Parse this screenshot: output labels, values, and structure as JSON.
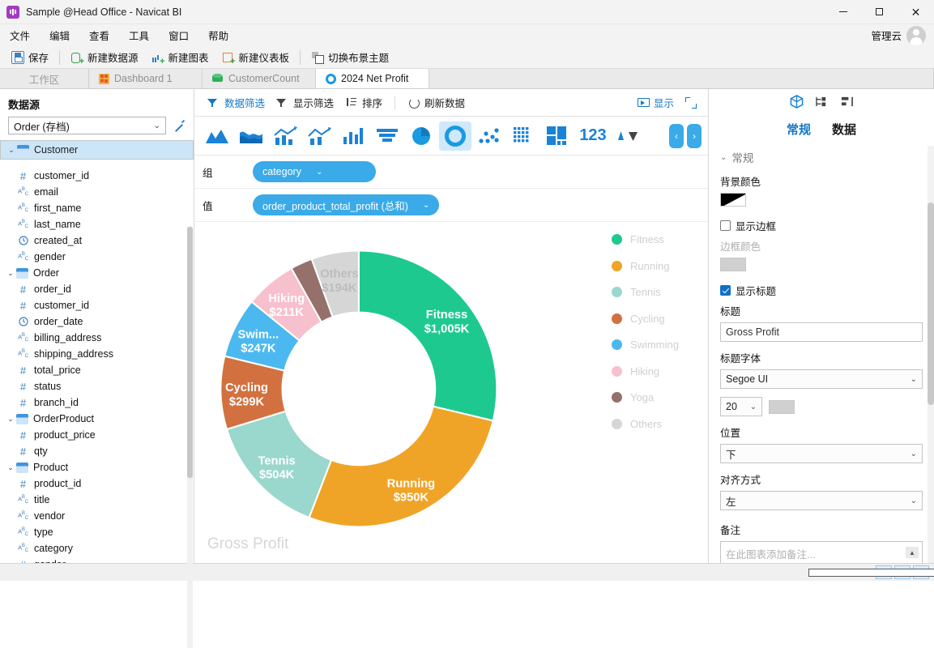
{
  "window": {
    "title": "Sample @Head Office - Navicat BI",
    "minimize": "–",
    "maximize": "□",
    "close": "✕"
  },
  "menu": {
    "items": [
      "文件",
      "编辑",
      "查看",
      "工具",
      "窗口",
      "帮助"
    ],
    "account": "管理云"
  },
  "toolbar": {
    "save": "保存",
    "new_datasource": "新建数据源",
    "new_chart": "新建图表",
    "new_dashboard": "新建仪表板",
    "switch_theme": "切换布景主题"
  },
  "tabs": {
    "workspace": "工作区",
    "items": [
      {
        "label": "Dashboard 1",
        "icon": "dashboard-icon",
        "active": false
      },
      {
        "label": "CustomerCount",
        "icon": "cube-icon",
        "active": false
      },
      {
        "label": "2024 Net Profit",
        "icon": "donut-icon",
        "active": true
      }
    ]
  },
  "sidebar": {
    "title": "数据源",
    "datasource": "Order (存档)",
    "tree": [
      {
        "type": "table",
        "label": "Customer",
        "selected": true
      },
      {
        "type": "num",
        "label": "customer_id"
      },
      {
        "type": "str",
        "label": "email"
      },
      {
        "type": "str",
        "label": "first_name"
      },
      {
        "type": "str",
        "label": "last_name"
      },
      {
        "type": "date",
        "label": "created_at"
      },
      {
        "type": "str",
        "label": "gender"
      },
      {
        "type": "table",
        "label": "Order"
      },
      {
        "type": "num",
        "label": "order_id"
      },
      {
        "type": "num",
        "label": "customer_id"
      },
      {
        "type": "date",
        "label": "order_date"
      },
      {
        "type": "str",
        "label": "billing_address"
      },
      {
        "type": "str",
        "label": "shipping_address"
      },
      {
        "type": "num",
        "label": "total_price"
      },
      {
        "type": "num",
        "label": "status"
      },
      {
        "type": "num",
        "label": "branch_id"
      },
      {
        "type": "table",
        "label": "OrderProduct"
      },
      {
        "type": "num",
        "label": "product_price"
      },
      {
        "type": "num",
        "label": "qty"
      },
      {
        "type": "table",
        "label": "Product"
      },
      {
        "type": "num",
        "label": "product_id"
      },
      {
        "type": "str",
        "label": "title"
      },
      {
        "type": "str",
        "label": "vendor"
      },
      {
        "type": "str",
        "label": "type"
      },
      {
        "type": "str",
        "label": "category"
      },
      {
        "type": "num",
        "label": "gender"
      }
    ]
  },
  "chart_toolbar": {
    "data_filter": "数据筛选",
    "display_filter": "显示筛选",
    "sort": "排序",
    "refresh": "刷新数据",
    "display": "显示",
    "fullscreen_icon": "expand-icon"
  },
  "chart_types": [
    {
      "name": "area-chart",
      "active": false
    },
    {
      "name": "stacked-area-chart",
      "active": false
    },
    {
      "name": "line-column-chart",
      "active": false
    },
    {
      "name": "line-bar-chart",
      "active": false
    },
    {
      "name": "column-chart",
      "active": false
    },
    {
      "name": "funnel-chart",
      "active": false
    },
    {
      "name": "pie-chart",
      "active": false
    },
    {
      "name": "donut-chart",
      "active": true
    },
    {
      "name": "scatter-chart",
      "active": false
    },
    {
      "name": "heatmap-chart",
      "active": false
    },
    {
      "name": "treemap-chart",
      "active": false
    },
    {
      "name": "value-chart",
      "active": false
    },
    {
      "name": "trend-chart",
      "active": false
    }
  ],
  "fields": {
    "group_label": "组",
    "group_value": "category",
    "value_label": "值",
    "value_value": "order_product_total_profit (总和)"
  },
  "chart_data": {
    "type": "pie",
    "title": "Gross Profit",
    "donut": true,
    "legend_position": "right",
    "categories": [
      "Fitness",
      "Running",
      "Tennis",
      "Cycling",
      "Swimming",
      "Hiking",
      "Yoga",
      "Others"
    ],
    "values": [
      1005,
      950,
      504,
      299,
      247,
      211,
      90,
      194
    ],
    "value_labels": [
      "$1,005K",
      "$950K",
      "$504K",
      "$299K",
      "$247K",
      "$211K",
      "",
      "$194K"
    ],
    "slice_labels": [
      "Fitness",
      "Running",
      "Tennis",
      "Cycling",
      "Swim...",
      "Hiking",
      "",
      "Others"
    ],
    "colors": [
      "#1ec98f",
      "#f0a427",
      "#9ad7cd",
      "#d2713f",
      "#4cb8f0",
      "#f7c0cd",
      "#96706a",
      "#d6d6d6"
    ],
    "unit": "K",
    "currency": "$",
    "xlabel": "category",
    "ylabel": "order_product_total_profit (总和)"
  },
  "right_panel": {
    "tabs": [
      {
        "label": "常规",
        "active": true
      },
      {
        "label": "数据",
        "active": false
      }
    ],
    "section_general": "常规",
    "bg_color_label": "背景颜色",
    "show_border_label": "显示边框",
    "show_border_checked": false,
    "border_color_label": "边框颜色",
    "show_title_label": "显示标题",
    "show_title_checked": true,
    "title_label": "标题",
    "title_value": "Gross Profit",
    "title_font_label": "标题字体",
    "title_font_value": "Segoe UI",
    "title_font_size": "20",
    "position_label": "位置",
    "position_value": "下",
    "align_label": "对齐方式",
    "align_value": "左",
    "note_label": "备注",
    "note_placeholder": "在此图表添加备注..."
  },
  "statusbar": {
    "layout_left": "layout-left-icon",
    "layout_bottom": "layout-bottom-icon",
    "layout_right": "layout-right-icon"
  }
}
